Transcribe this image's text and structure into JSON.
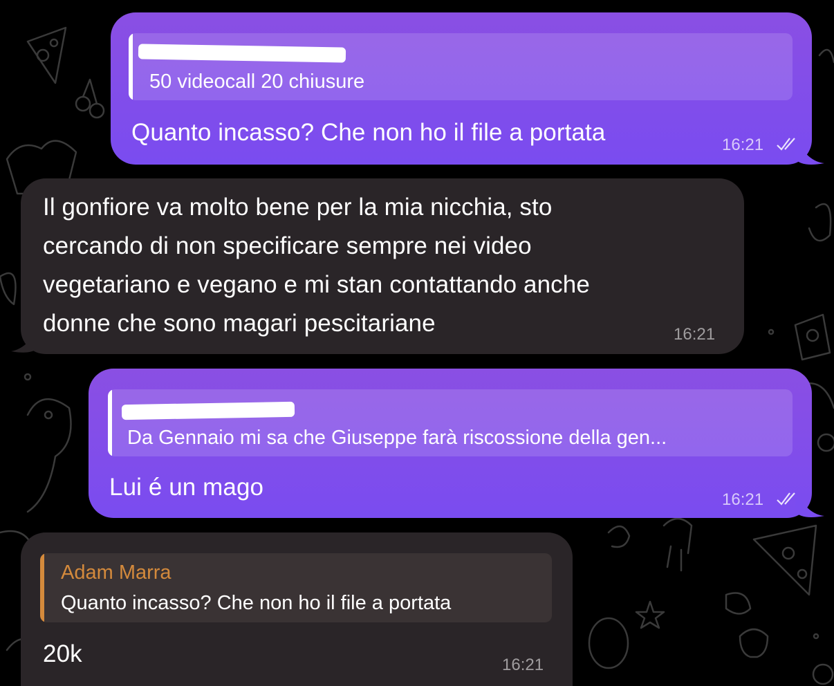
{
  "colors": {
    "background": "#000000",
    "outgoing_bubble": "#7f4ee9",
    "incoming_bubble": "#2a2528",
    "reply_author_accent": "#d48a3c"
  },
  "messages": [
    {
      "direction": "outgoing",
      "reply": {
        "author": "",
        "author_redacted": true,
        "text": "50 videocall 20 chiusure"
      },
      "text": "Quanto incasso? Che non ho il file a portata",
      "time": "16:21",
      "status_icon": "double-check-icon"
    },
    {
      "direction": "incoming",
      "text": "Il gonfiore va molto bene per la mia nicchia, sto\ncercando di non specificare sempre nei video\nvegetariano e vegano e mi stan contattando anche\ndonne che sono magari pescitariane",
      "time": "16:21"
    },
    {
      "direction": "outgoing",
      "reply": {
        "author": "",
        "author_redacted": true,
        "text": "Da Gennaio mi sa che Giuseppe farà riscossione della gen..."
      },
      "text": "Lui é un mago",
      "time": "16:21",
      "status_icon": "double-check-icon"
    },
    {
      "direction": "incoming",
      "reply": {
        "author": "Adam Marra",
        "text": "Quanto incasso? Che non ho il file a portata"
      },
      "text": "20k",
      "time": "16:21"
    }
  ]
}
